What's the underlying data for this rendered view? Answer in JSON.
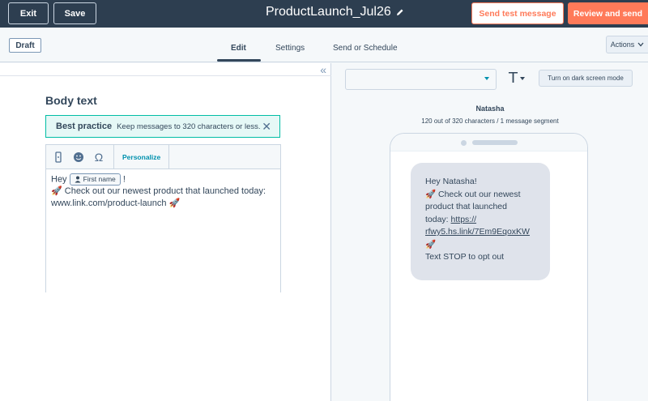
{
  "topbar": {
    "exit_label": "Exit",
    "save_label": "Save",
    "title": "ProductLaunch_Jul26",
    "send_test_label": "Send test message",
    "review_label": "Review and send"
  },
  "tabs": {
    "status_badge": "Draft",
    "items": [
      "Edit",
      "Settings",
      "Send or Schedule"
    ],
    "actions_label": "Actions"
  },
  "editor": {
    "heading": "Body text",
    "best_practice": {
      "title": "Best practice",
      "text": "Keep messages to 320 characters or less."
    },
    "personalize_label": "Personalize",
    "body": {
      "greeting": "Hey",
      "token_label": "First name",
      "after_token": "!",
      "line2": "🚀 Check out our newest product that launched today:",
      "line3": "www.link.com/product-launch 🚀"
    }
  },
  "preview": {
    "dark_mode_label": "Turn on dark screen mode",
    "contact_name": "Natasha",
    "char_count": "120 out of 320 characters / 1 message segment",
    "message": {
      "line1": "Hey Natasha!",
      "line2": "🚀 Check out our newest",
      "line3": "product that launched",
      "line4_prefix": "today: ",
      "link1": "https://",
      "link2": "rfwy5.hs.link/7Em9EqoxKW",
      "rocket": "🚀",
      "line6": "Text STOP to opt out"
    }
  },
  "icons": {
    "edit": "pencil-icon",
    "collapse": "double-chevron-left-icon",
    "close": "close-icon",
    "mobile": "mobile-icon",
    "emoji": "emoji-icon",
    "special_chars": "omega-icon",
    "contact": "person-icon",
    "text_style": "text-format-icon"
  },
  "colors": {
    "topbar_bg": "#2d3e50",
    "accent": "#ff7a59",
    "teal": "#00bda5",
    "link": "#0091ae"
  }
}
